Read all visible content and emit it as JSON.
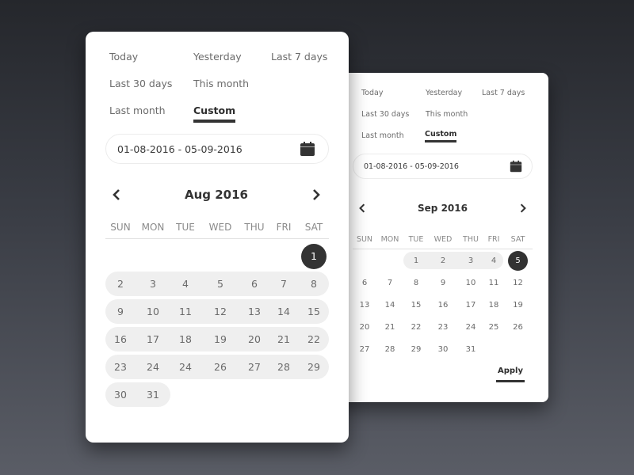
{
  "colors": {
    "background_top": "#25272c",
    "background_bottom": "#5a5d66",
    "card": "#ffffff",
    "accent": "#333333",
    "range_fill": "#efefef",
    "text_muted": "#6b6b6b"
  },
  "front": {
    "presets": [
      {
        "label": "Today",
        "active": false
      },
      {
        "label": "Yesterday",
        "active": false
      },
      {
        "label": "Last 7 days",
        "active": false
      },
      {
        "label": "Last 30 days",
        "active": false
      },
      {
        "label": "This month",
        "active": false
      },
      {
        "label": "Last month",
        "active": false
      },
      {
        "label": "Custom",
        "active": true
      }
    ],
    "range_value": "01-08-2016 - 05-09-2016",
    "calendar_icon": "calendar-icon",
    "month_title": "Aug 2016",
    "prev_icon": "chevron-left-icon",
    "next_icon": "chevron-right-icon",
    "weekdays": [
      "SUN",
      "MON",
      "TUE",
      "WED",
      "THU",
      "FRI",
      "SAT"
    ],
    "weeks": [
      [
        "",
        "",
        "",
        "",
        "",
        "",
        "1"
      ],
      [
        "2",
        "3",
        "4",
        "5",
        "6",
        "7",
        "8"
      ],
      [
        "9",
        "10",
        "11",
        "12",
        "13",
        "14",
        "15"
      ],
      [
        "16",
        "17",
        "18",
        "19",
        "20",
        "21",
        "22"
      ],
      [
        "23",
        "24",
        "24",
        "26",
        "27",
        "28",
        "29"
      ],
      [
        "30",
        "31",
        "",
        "",
        "",
        "",
        ""
      ]
    ],
    "selected_day": "1",
    "range_start_day": "1",
    "in_range_from_week": 1
  },
  "back": {
    "presets": [
      {
        "label": "Today",
        "active": false
      },
      {
        "label": "Yesterday",
        "active": false
      },
      {
        "label": "Last 7 days",
        "active": false
      },
      {
        "label": "Last 30 days",
        "active": false
      },
      {
        "label": "This month",
        "active": false
      },
      {
        "label": "Last month",
        "active": false
      },
      {
        "label": "Custom",
        "active": true
      }
    ],
    "range_value": "01-08-2016 - 05-09-2016",
    "calendar_icon": "calendar-icon",
    "month_title": "Sep 2016",
    "prev_icon": "chevron-left-icon",
    "next_icon": "chevron-right-icon",
    "weekdays": [
      "SUN",
      "MON",
      "TUE",
      "WED",
      "THU",
      "FRI",
      "SAT"
    ],
    "weeks": [
      [
        "",
        "",
        "1",
        "2",
        "3",
        "4",
        "5"
      ],
      [
        "6",
        "7",
        "8",
        "9",
        "10",
        "11",
        "12"
      ],
      [
        "13",
        "14",
        "15",
        "16",
        "17",
        "18",
        "19"
      ],
      [
        "20",
        "21",
        "22",
        "23",
        "24",
        "25",
        "26"
      ],
      [
        "27",
        "28",
        "29",
        "30",
        "31",
        "",
        ""
      ]
    ],
    "selected_day": "5",
    "apply_label": "Apply"
  }
}
